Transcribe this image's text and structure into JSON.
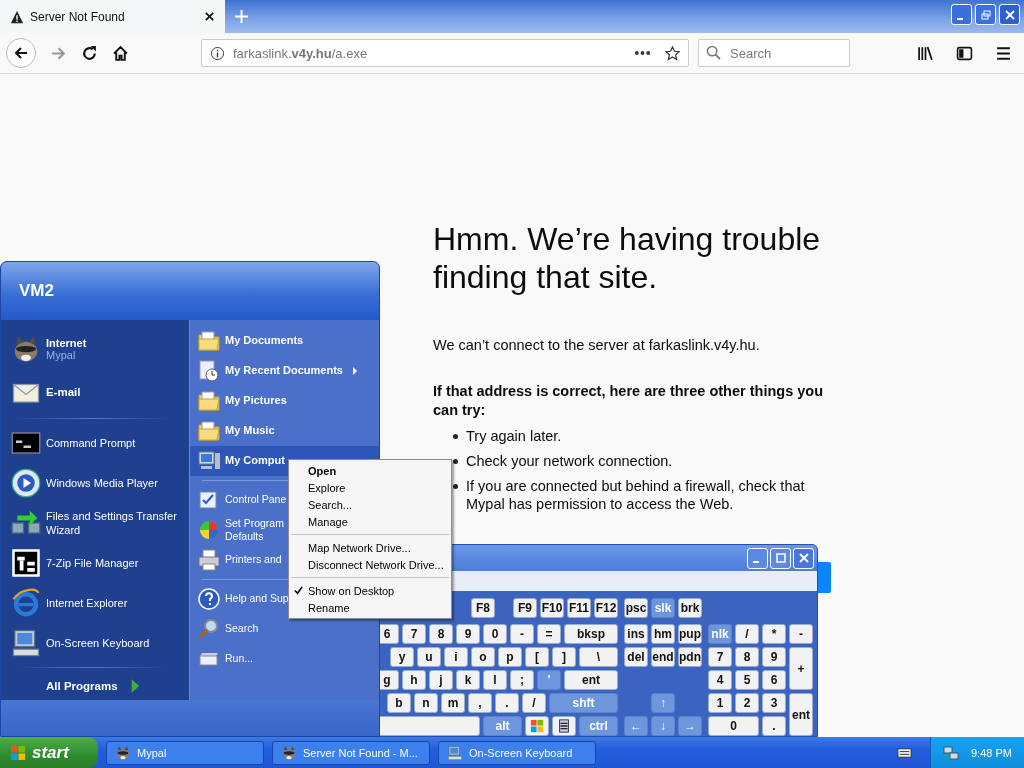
{
  "browser": {
    "tab": {
      "title": "Server Not Found"
    },
    "url": "farkaslink.**v4y.hu**/a.exe",
    "search": {
      "placeholder": "Search"
    }
  },
  "page": {
    "heading": "Hmm. We’re having trouble finding that site.",
    "message": "We can’t connect to the server at farkaslink.v4y.hu.",
    "subheading": "If that address is correct, here are three other things you can try:",
    "suggestions": [
      "Try again later.",
      "Check your network connection.",
      "If you are connected but behind a firewall, check that Mypal has permission to access the Web."
    ]
  },
  "start_menu": {
    "user": "VM2",
    "pinned": [
      {
        "title": "Internet",
        "subtitle": "Mypal"
      },
      {
        "title": "E-mail"
      }
    ],
    "programs": [
      "Command Prompt",
      "Windows Media Player",
      "Files and Settings Transfer Wizard",
      "7-Zip File Manager",
      "Internet Explorer",
      "On-Screen Keyboard"
    ],
    "all_programs": "All Programs",
    "places": [
      [
        {
          "label": "My Documents",
          "kind": "place",
          "selected": false,
          "submenu": false
        },
        {
          "label": "My Recent Documents",
          "kind": "place",
          "selected": false,
          "submenu": true
        },
        {
          "label": "My Pictures",
          "kind": "place",
          "selected": false,
          "submenu": false
        },
        {
          "label": "My Music",
          "kind": "place",
          "selected": false,
          "submenu": false
        },
        {
          "label": "My Comput",
          "kind": "place",
          "selected": true,
          "submenu": false
        }
      ],
      [
        {
          "label": "Control Pane",
          "kind": "link",
          "selected": false,
          "submenu": false
        },
        {
          "label": "Set Program Defaults",
          "kind": "link",
          "selected": false,
          "submenu": false
        },
        {
          "label": "Printers and",
          "kind": "link",
          "selected": false,
          "submenu": false
        }
      ],
      [
        {
          "label": "Help and Sup",
          "kind": "link",
          "selected": false,
          "submenu": false
        },
        {
          "label": "Search",
          "kind": "link",
          "selected": false,
          "submenu": false
        },
        {
          "label": "Run...",
          "kind": "link",
          "selected": false,
          "submenu": false
        }
      ]
    ]
  },
  "context_menu": {
    "groups": [
      [
        {
          "label": "Open",
          "default": true,
          "checked": false
        },
        {
          "label": "Explore",
          "default": false,
          "checked": false
        },
        {
          "label": "Search...",
          "default": false,
          "checked": false
        },
        {
          "label": "Manage",
          "default": false,
          "checked": false
        }
      ],
      [
        {
          "label": "Map Network Drive...",
          "default": false,
          "checked": false
        },
        {
          "label": "Disconnect Network Drive...",
          "default": false,
          "checked": false
        }
      ],
      [
        {
          "label": "Show on Desktop",
          "default": false,
          "checked": true
        },
        {
          "label": "Rename",
          "default": false,
          "checked": false
        }
      ]
    ]
  },
  "keyboard": {
    "function_groups": [
      [
        {
          "label": "F8",
          "highlighted": false
        }
      ],
      [
        {
          "label": "F9",
          "highlighted": false
        },
        {
          "label": "F10",
          "highlighted": false
        },
        {
          "label": "F11",
          "highlighted": false
        },
        {
          "label": "F12",
          "highlighted": false
        }
      ]
    ],
    "main_rows": [
      [
        {
          "label": "6",
          "kind": "key",
          "highlighted": false
        },
        {
          "label": "7",
          "kind": "key",
          "highlighted": false
        },
        {
          "label": "8",
          "kind": "key",
          "highlighted": false
        },
        {
          "label": "9",
          "kind": "key",
          "highlighted": false
        },
        {
          "label": "0",
          "kind": "key",
          "highlighted": false
        },
        {
          "label": "-",
          "kind": "key",
          "highlighted": false
        },
        {
          "label": "=",
          "kind": "key",
          "highlighted": false
        },
        {
          "label": "bksp",
          "kind": "wide",
          "highlighted": false
        }
      ],
      [
        {
          "label": "y",
          "kind": "key",
          "highlighted": false
        },
        {
          "label": "u",
          "kind": "key",
          "highlighted": false
        },
        {
          "label": "i",
          "kind": "key",
          "highlighted": false
        },
        {
          "label": "o",
          "kind": "key",
          "highlighted": false
        },
        {
          "label": "p",
          "kind": "key",
          "highlighted": false
        },
        {
          "label": "[",
          "kind": "key",
          "highlighted": false
        },
        {
          "label": "]",
          "kind": "key",
          "highlighted": false
        },
        {
          "label": "\\",
          "kind": "medium",
          "highlighted": false
        }
      ],
      [
        {
          "label": "g",
          "kind": "key",
          "highlighted": false
        },
        {
          "label": "h",
          "kind": "key",
          "highlighted": false
        },
        {
          "label": "j",
          "kind": "key",
          "highlighted": false
        },
        {
          "label": "k",
          "kind": "key",
          "highlighted": false
        },
        {
          "label": "l",
          "kind": "key",
          "highlighted": false
        },
        {
          "label": ";",
          "kind": "key",
          "highlighted": false
        },
        {
          "label": "'",
          "kind": "key",
          "highlighted": true
        },
        {
          "label": "ent",
          "kind": "wide",
          "highlighted": false
        }
      ],
      [
        {
          "label": "b",
          "kind": "key",
          "highlighted": false
        },
        {
          "label": "n",
          "kind": "key",
          "highlighted": false
        },
        {
          "label": "m",
          "kind": "key",
          "highlighted": false
        },
        {
          "label": ",",
          "kind": "key",
          "highlighted": false
        },
        {
          "label": ".",
          "kind": "key",
          "highlighted": false
        },
        {
          "label": "/",
          "kind": "key",
          "highlighted": false
        },
        {
          "label": "shft",
          "kind": "shift",
          "highlighted": true
        }
      ],
      [
        {
          "kind": "space",
          "highlighted": false
        },
        {
          "label": "alt",
          "kind": "medium",
          "highlighted": true
        },
        {
          "kind": "windows",
          "highlighted": false
        },
        {
          "kind": "menu",
          "highlighted": false
        },
        {
          "label": "ctrl",
          "kind": "medium",
          "highlighted": true
        }
      ]
    ],
    "nav_keys": [
      {
        "label": "psc",
        "highlighted": false
      },
      {
        "label": "slk",
        "highlighted": true
      },
      {
        "label": "brk",
        "highlighted": false
      },
      {
        "label": "ins",
        "highlighted": false
      },
      {
        "label": "hm",
        "highlighted": false
      },
      {
        "label": "pup",
        "highlighted": false
      },
      {
        "label": "del",
        "highlighted": false
      },
      {
        "label": "end",
        "highlighted": false
      },
      {
        "label": "pdn",
        "highlighted": false
      }
    ],
    "arrow_keys": [
      {
        "label": "↑",
        "highlighted": true
      },
      {
        "label": "←",
        "highlighted": true
      },
      {
        "label": "↓",
        "highlighted": true
      },
      {
        "label": "→",
        "highlighted": true
      }
    ],
    "numpad": [
      {
        "label": "nlk",
        "kind": "key",
        "highlighted": true
      },
      {
        "label": "/",
        "kind": "key",
        "highlighted": false
      },
      {
        "label": "*",
        "kind": "key",
        "highlighted": false
      },
      {
        "label": "-",
        "kind": "key",
        "highlighted": false
      },
      {
        "label": "7",
        "kind": "key",
        "highlighted": false
      },
      {
        "label": "8",
        "kind": "key",
        "highlighted": false
      },
      {
        "label": "9",
        "kind": "key",
        "highlighted": false
      },
      {
        "label": "+",
        "kind": "tall",
        "highlighted": false
      },
      {
        "label": "4",
        "kind": "key",
        "highlighted": false
      },
      {
        "label": "5",
        "kind": "key",
        "highlighted": false
      },
      {
        "label": "6",
        "kind": "key",
        "highlighted": false
      },
      {
        "label": "1",
        "kind": "key",
        "highlighted": false
      },
      {
        "label": "2",
        "kind": "key",
        "highlighted": false
      },
      {
        "label": "3",
        "kind": "key",
        "highlighted": false
      },
      {
        "label": "ent",
        "kind": "tall",
        "highlighted": false
      },
      {
        "label": "0",
        "kind": "wide",
        "highlighted": false
      },
      {
        "label": ".",
        "kind": "key",
        "highlighted": false
      }
    ]
  },
  "taskbar": {
    "start": "start",
    "tasks": [
      "Mypal",
      "Server Not Found - M...",
      "On-Screen Keyboard"
    ],
    "clock": "9:48 PM"
  }
}
